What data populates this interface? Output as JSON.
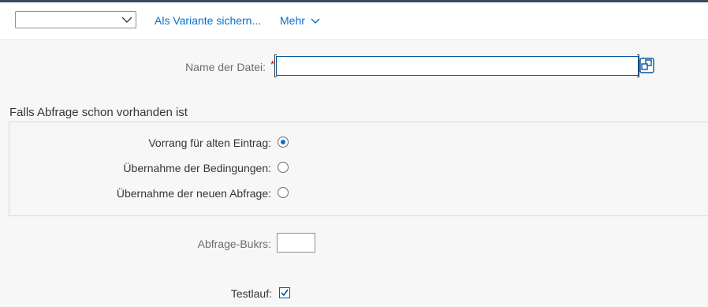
{
  "toolbar": {
    "variant_value": "",
    "save_variant_label": "Als Variante sichern...",
    "more_label": "Mehr"
  },
  "form": {
    "file_name": {
      "label": "Name der Datei:",
      "required_mark": "*",
      "value": ""
    },
    "section_title": "Falls Abfrage schon vorhanden ist",
    "radios": [
      {
        "label": "Vorrang für alten Eintrag:",
        "checked": true
      },
      {
        "label": "Übernahme der Bedingungen:",
        "checked": false
      },
      {
        "label": "Übernahme der neuen Abfrage:",
        "checked": false
      }
    ],
    "bukrs": {
      "label": "Abfrage-Bukrs:",
      "value": ""
    },
    "testlauf": {
      "label": "Testlauf:",
      "checked": true
    }
  },
  "colors": {
    "accent": "#0a6ed1",
    "required": "#bb0000",
    "shell": "#354a5f"
  }
}
